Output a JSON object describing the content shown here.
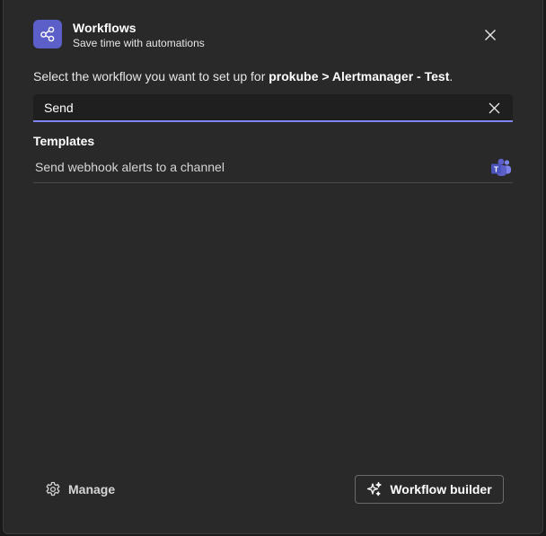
{
  "header": {
    "title": "Workflows",
    "subtitle": "Save time with automations",
    "icon": "workflow-share-icon",
    "icon_bg": "#5b5fc7"
  },
  "instruction": {
    "prefix": "Select the workflow you want to set up for ",
    "target": "prokube > Alertmanager - Test",
    "suffix": "."
  },
  "search": {
    "value": "Send",
    "placeholder": "",
    "accent_color": "#7f85f5"
  },
  "templates": {
    "heading": "Templates",
    "items": [
      {
        "label": "Send webhook alerts to a channel",
        "icon": "teams-icon"
      }
    ]
  },
  "footer": {
    "manage_label": "Manage",
    "builder_label": "Workflow builder"
  }
}
